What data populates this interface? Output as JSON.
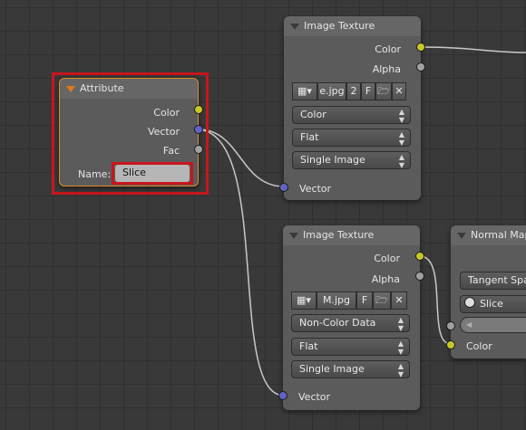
{
  "attribute_node": {
    "title": "Attribute",
    "outputs": [
      "Color",
      "Vector",
      "Fac"
    ],
    "name_label": "Name:",
    "name_value": "Slice"
  },
  "image_texture_1": {
    "title": "Image Texture",
    "outputs": [
      "Color",
      "Alpha"
    ],
    "image_name": "e.jpg",
    "users": "2",
    "fake_user": "F",
    "color_space": "Color",
    "projection": "Flat",
    "source": "Single Image",
    "input": "Vector"
  },
  "image_texture_2": {
    "title": "Image Texture",
    "outputs": [
      "Color",
      "Alpha"
    ],
    "image_name": "M.jpg",
    "fake_user": "F",
    "color_space": "Non-Color Data",
    "projection": "Flat",
    "source": "Single Image",
    "input": "Vector"
  },
  "normal_map_node": {
    "title": "Normal Map",
    "space": "Tangent Space",
    "uv_map": "Slice",
    "input": "Color"
  },
  "colors": {
    "selection": "#c8161d",
    "socket_color": "#c7c729",
    "socket_vector": "#6363c7",
    "socket_float": "#a1a1a1",
    "active_header_triangle": "#e07a1a"
  }
}
